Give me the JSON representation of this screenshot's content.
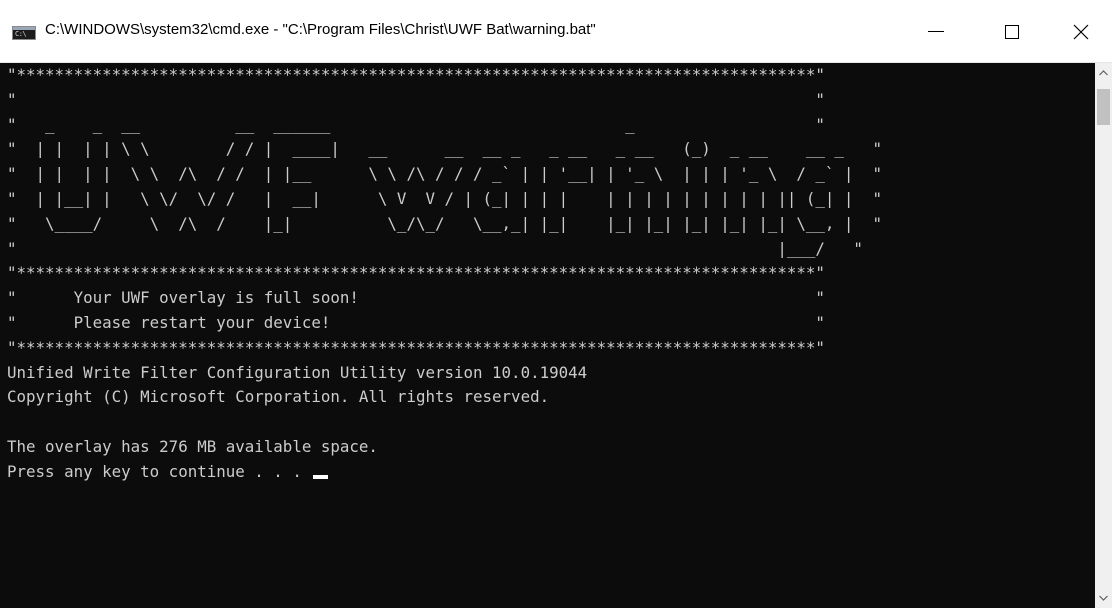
{
  "window": {
    "title": "C:\\WINDOWS\\system32\\cmd.exe - \"C:\\Program Files\\Christ\\UWF Bat\\warning.bat\"",
    "icon": "cmd-icon",
    "icon_text": "C:\\",
    "controls": [
      "minimize-icon",
      "maximize-icon",
      "close-icon"
    ]
  },
  "console": {
    "lines": [
      "\"************************************************************************************\"",
      "\"                                                                                    \"",
      "\"   _    _  __          __  ______                               _                   \"",
      "\"  | |  | | \\ \\        / / |  ____|   __      __  __ _   _ __   _ __   (_)  _ __    __ _   \"",
      "\"  | |  | |  \\ \\  /\\  / /  | |__      \\ \\ /\\ / / / _` | | '__| | '_ \\  | | | '_ \\  / _` |  \"",
      "\"  | |__| |   \\ \\/  \\/ /   |  __|      \\ V  V / | (_| | | |    | | | | | | | | | || (_| |  \"",
      "\"   \\____/     \\  /\\  /    |_|          \\_/\\_/   \\__,_| |_|    |_| |_| |_| |_| |_| \\__, |  \"",
      "\"                                                                                |___/   \"",
      "\"************************************************************************************\"",
      "\"      Your UWF overlay is full soon!                                                \"",
      "\"      Please restart your device!                                                   \"",
      "\"************************************************************************************\"",
      "Unified Write Filter Configuration Utility version 10.0.19044",
      "Copyright (C) Microsoft Corporation. All rights reserved.",
      "",
      "The overlay has 276 MB available space.",
      "Press any key to continue . . . "
    ]
  },
  "colors": {
    "console_background": "#0c0c0c",
    "console_text": "#cccccc",
    "titlebar_background": "#ffffff",
    "cursor": "#ffffff"
  }
}
